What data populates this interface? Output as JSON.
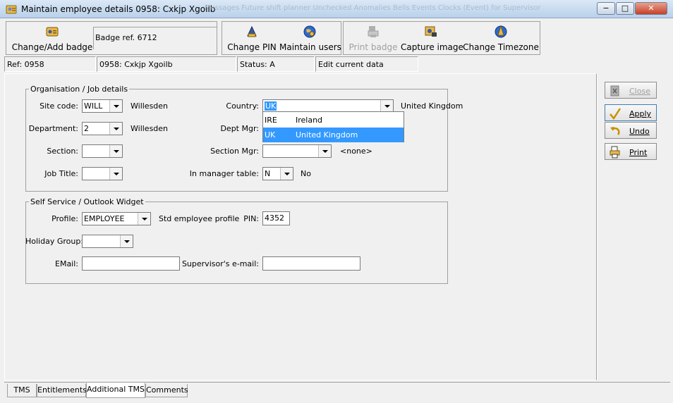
{
  "window": {
    "title": "Maintain employee details 0958: Cxkjp Xgoilb",
    "ghost_text": "Messages     Future shift planner     Unchecked Anomalies     Bells Events     Clocks (Event) for     Supervisor",
    "controls": {
      "minimize": "−",
      "maximize": "□",
      "close": "✕"
    }
  },
  "toolbar": {
    "change_badge_label": "Change/Add badge",
    "badge_ref": "Badge ref. 6712",
    "change_pin_label": "Change PIN",
    "maintain_users_label": "Maintain users",
    "print_badge_label": "Print badge",
    "capture_image_label": "Capture image",
    "change_timezone_label": "Change Timezone"
  },
  "status": {
    "ref": "Ref: 0958",
    "employee": "0958: Cxkjp Xgoilb",
    "status": "Status: A",
    "mode": "Edit current data"
  },
  "org": {
    "title": "Organisation / Job details",
    "site_code_label": "Site code:",
    "site_code_value": "WILL",
    "site_code_desc": "Willesden",
    "department_label": "Department:",
    "department_value": "2",
    "department_desc": "Willesden",
    "section_label": "Section:",
    "section_value": "",
    "job_title_label": "Job Title:",
    "job_title_value": "",
    "country_label": "Country:",
    "country_value": "UK",
    "country_desc": "United Kingdom",
    "dept_mgr_label": "Dept Mgr:",
    "section_mgr_label": "Section Mgr:",
    "section_mgr_value": "",
    "section_mgr_desc": "<none>",
    "in_manager_label": "In manager table:",
    "in_manager_value": "N",
    "in_manager_desc": "No",
    "country_options": [
      {
        "code": "IRE",
        "name": "Ireland",
        "selected": false
      },
      {
        "code": "UK",
        "name": "United Kingdom",
        "selected": true
      }
    ]
  },
  "self_service": {
    "title": "Self Service / Outlook Widget",
    "profile_label": "Profile:",
    "profile_value": "EMPLOYEE",
    "profile_desc": "Std employee profile",
    "pin_label": "PIN:",
    "pin_value": "4352",
    "holiday_label": "Holiday Group:",
    "holiday_value": "",
    "email_label": "EMail:",
    "email_value": "",
    "supervisor_email_label": "Supervisor's e-mail:",
    "supervisor_email_value": ""
  },
  "side_buttons": {
    "close": "Close",
    "apply": "Apply",
    "undo": "Undo",
    "print": "Print"
  },
  "tabs": [
    "TMS",
    "Entitlements",
    "Additional TMS",
    "Comments"
  ],
  "active_tab": "Additional TMS"
}
